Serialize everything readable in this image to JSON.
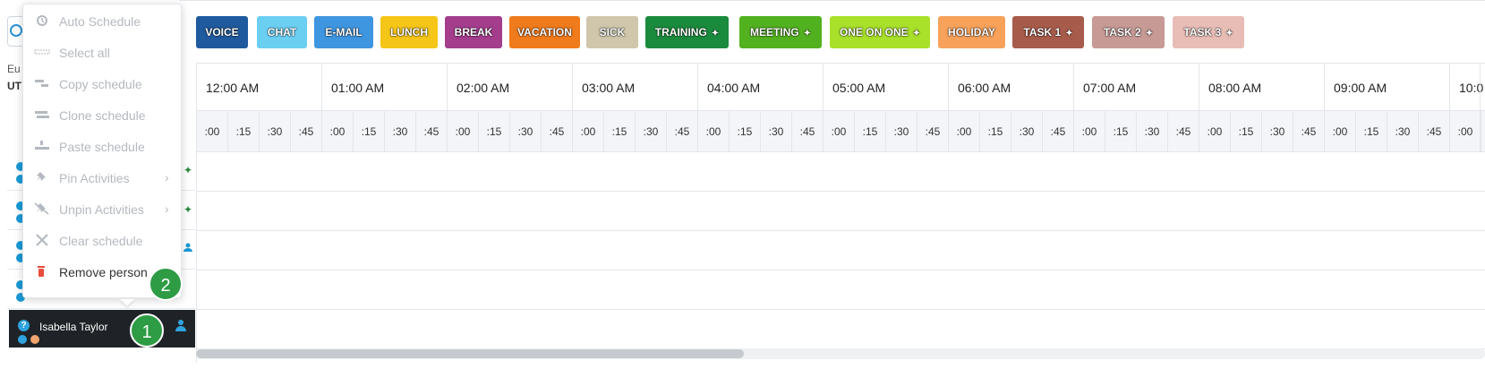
{
  "timezone": {
    "line1": "Eu",
    "line2": "UT"
  },
  "context_menu": {
    "items": [
      {
        "label": "Auto Schedule",
        "icon": "auto-schedule-icon",
        "enabled": false,
        "submenu": false
      },
      {
        "label": "Select all",
        "icon": "select-all-icon",
        "enabled": false,
        "submenu": false
      },
      {
        "label": "Copy schedule",
        "icon": "copy-schedule-icon",
        "enabled": false,
        "submenu": false
      },
      {
        "label": "Clone schedule",
        "icon": "clone-schedule-icon",
        "enabled": false,
        "submenu": false
      },
      {
        "label": "Paste schedule",
        "icon": "paste-schedule-icon",
        "enabled": false,
        "submenu": false
      },
      {
        "label": "Pin Activities",
        "icon": "pin-icon",
        "enabled": false,
        "submenu": true
      },
      {
        "label": "Unpin Activities",
        "icon": "unpin-icon",
        "enabled": false,
        "submenu": true
      },
      {
        "label": "Clear schedule",
        "icon": "close-icon",
        "enabled": false,
        "submenu": false
      },
      {
        "label": "Remove person",
        "icon": "trash-icon",
        "enabled": true,
        "submenu": false
      }
    ],
    "chevron": "›"
  },
  "legend": [
    {
      "label": "VOICE",
      "color": "#1f5a9e"
    },
    {
      "label": "CHAT",
      "color": "#6bcff2"
    },
    {
      "label": "E-MAIL",
      "color": "#3f96e0"
    },
    {
      "label": "LUNCH",
      "color": "#f5c518"
    },
    {
      "label": "BREAK",
      "color": "#a33d8c"
    },
    {
      "label": "VACATION",
      "color": "#f07b1c"
    },
    {
      "label": "SICK",
      "color": "#cfc6ab"
    },
    {
      "label": "TRAINING",
      "color": "#1a8a3c",
      "pinned": true
    },
    {
      "label": "MEETING",
      "color": "#52b11f",
      "pinned": true
    },
    {
      "label": "ONE ON ONE",
      "color": "#a8e02a",
      "pinned": true
    },
    {
      "label": "HOLIDAY",
      "color": "#f7a15a"
    },
    {
      "label": "TASK 1",
      "color": "#a75b4a",
      "pinned": true
    },
    {
      "label": "TASK 2",
      "color": "#c79a95",
      "pinned": true
    },
    {
      "label": "TASK 3",
      "color": "#e7bdb5",
      "pinned": true
    }
  ],
  "pin_glyph": "✦",
  "timeline": {
    "hours": [
      "12:00 AM",
      "01:00 AM",
      "02:00 AM",
      "03:00 AM",
      "04:00 AM",
      "05:00 AM",
      "06:00 AM",
      "07:00 AM",
      "08:00 AM",
      "09:00 AM",
      "10:0"
    ],
    "minutes": [
      ":00",
      ":15",
      ":30",
      ":45"
    ]
  },
  "people": {
    "active": {
      "name": "Isabella Taylor",
      "status": "?"
    },
    "rows": [
      {
        "mark": "pin"
      },
      {
        "mark": "pin"
      },
      {
        "mark": "user"
      },
      {
        "mark": "none"
      }
    ]
  },
  "badges": {
    "one": "1",
    "two": "2"
  }
}
